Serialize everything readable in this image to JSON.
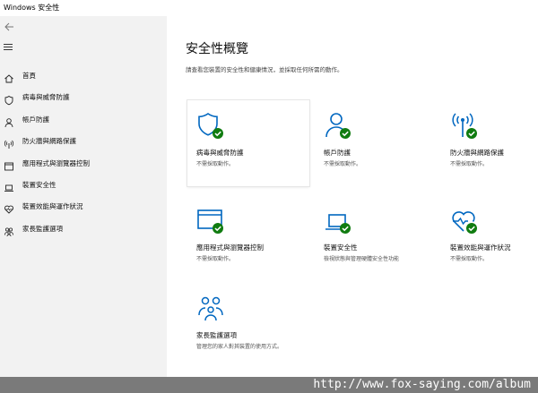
{
  "window": {
    "title": "Windows 安全性"
  },
  "sidebar": {
    "items": [
      {
        "label": "首頁",
        "icon": "home-icon"
      },
      {
        "label": "病毒與威脅防護",
        "icon": "shield-icon"
      },
      {
        "label": "帳戶防護",
        "icon": "person-icon"
      },
      {
        "label": "防火牆與網路保護",
        "icon": "wifi-antenna-icon"
      },
      {
        "label": "應用程式與瀏覽器控制",
        "icon": "browser-window-icon"
      },
      {
        "label": "裝置安全性",
        "icon": "laptop-icon"
      },
      {
        "label": "裝置效能與運作狀況",
        "icon": "heart-icon"
      },
      {
        "label": "家長監護選項",
        "icon": "family-icon"
      }
    ]
  },
  "main": {
    "title": "安全性概覽",
    "description": "請查看您裝置的安全性和健康情況，並採取任何所需的動作。",
    "tiles": [
      {
        "label": "病毒與威脅防護",
        "status": "不需採取動作。",
        "icon": "shield-check-icon"
      },
      {
        "label": "帳戶防護",
        "status": "不需採取動作。",
        "icon": "person-check-icon"
      },
      {
        "label": "防火牆與網路保護",
        "status": "不需採取動作。",
        "icon": "antenna-check-icon"
      },
      {
        "label": "應用程式與瀏覽器控制",
        "status": "不需採取動作。",
        "icon": "browser-check-icon"
      },
      {
        "label": "裝置安全性",
        "status": "檢視狀態與管理硬體安全性功能",
        "icon": "laptop-check-icon"
      },
      {
        "label": "裝置效能與運作狀況",
        "status": "不需採取動作。",
        "icon": "heart-check-icon"
      },
      {
        "label": "家長監護選項",
        "status": "管理您的家人對其裝置的使用方式。",
        "icon": "family-icon"
      }
    ]
  },
  "colors": {
    "accent": "#0067c0",
    "ok": "#107c10",
    "sidebar_bg": "#f2f2f2"
  },
  "watermark": "http://www.fox-saying.com/album"
}
